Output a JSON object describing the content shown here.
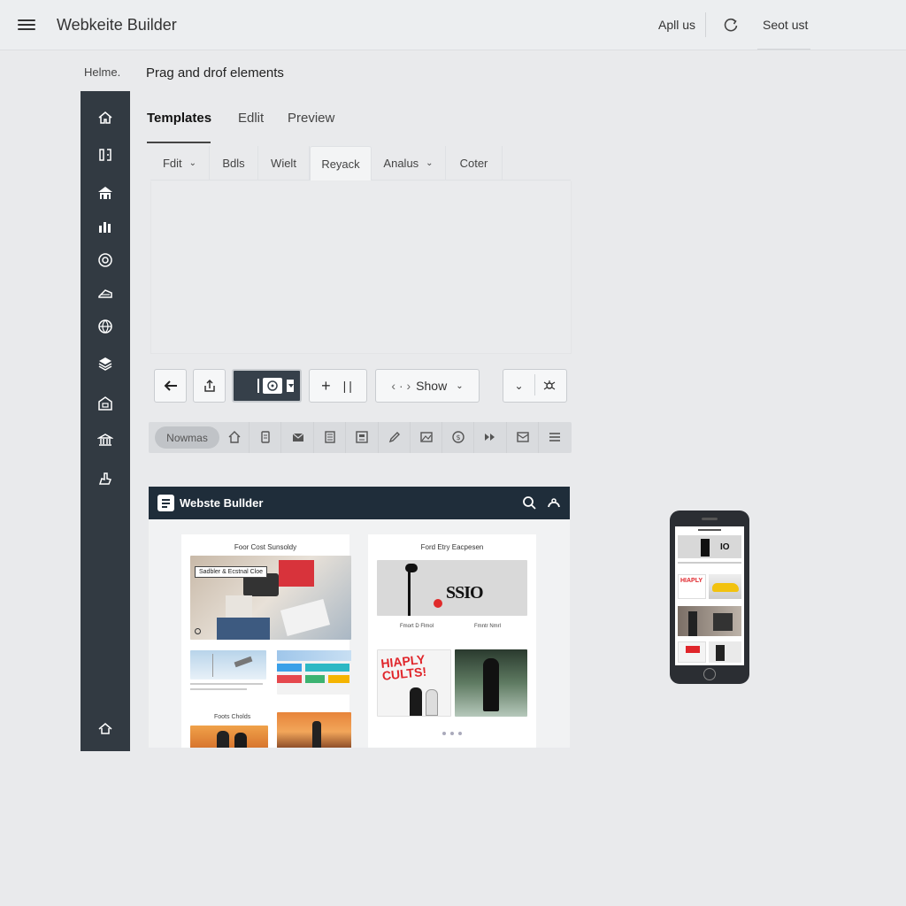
{
  "topbar": {
    "title": "Webkeite Builder",
    "apply_label": "Apll us",
    "settings_label": "Seot ust"
  },
  "header": {
    "breadcrumb": "Helme.",
    "page_title": "Prag and drof elements"
  },
  "tabs": [
    {
      "label": "Templates"
    },
    {
      "label": "Edlit"
    },
    {
      "label": "Preview"
    }
  ],
  "subbar": [
    {
      "label": "Fdit"
    },
    {
      "label": "Bdls"
    },
    {
      "label": "Wielt"
    },
    {
      "label": "Reyack"
    },
    {
      "label": "Analus"
    },
    {
      "label": "Coter"
    }
  ],
  "controls": {
    "show_label": "Show",
    "nav_arrows": "‹ · ›"
  },
  "strip": {
    "pill_label": "Nowmas"
  },
  "preview": {
    "title": "Webste Bullder",
    "card1_title": "Foor Cost Sunsoldy",
    "card1_overlay": "Sadbler & Ecstnal Cloe",
    "card1_footer_title": "Foots Cholds",
    "card2_title": "Ford Etry Eacpesen",
    "card2_caption_left": "Fmort D Flmol",
    "card2_caption_right": "Fmntr Nmrl",
    "card2_banner_text": "HIAPLY CULTS!",
    "card2_logo_text": "SSIO"
  },
  "colors": {
    "sidebar": "#323a42",
    "preview_header": "#1f2d3a",
    "background": "#e9eaec"
  }
}
